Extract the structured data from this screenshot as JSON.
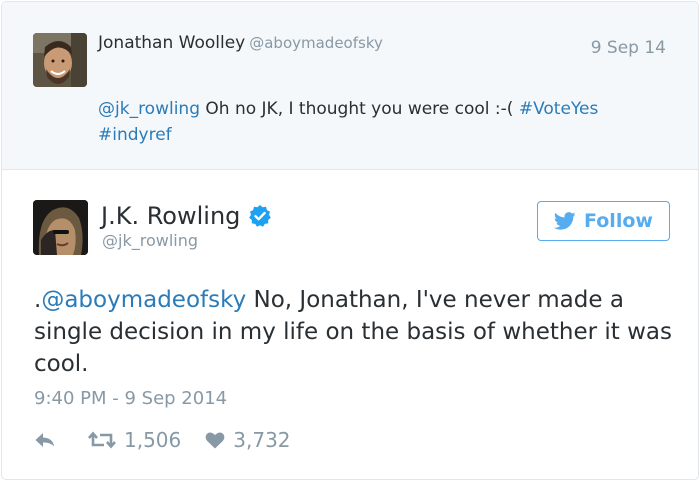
{
  "reply_tweet": {
    "author_name": "Jonathan Woolley",
    "author_handle": "@aboymadeofsky",
    "date": "9 Sep 14",
    "mention": "@jk_rowling",
    "text": " Oh no JK, I thought you were cool :-( ",
    "hashtag_1": "#VoteYes",
    "hashtag_2": "#indyref"
  },
  "main_tweet": {
    "author_name": "J.K. Rowling",
    "author_handle": "@jk_rowling",
    "verified_icon": "verified-badge-icon",
    "follow_label": "Follow",
    "text_prefix": ".",
    "mention": "@aboymadeofsky",
    "text": " No, Jonathan, I've never made a single decision in my life on the basis of whether it was cool.",
    "timestamp": "9:40 PM - 9 Sep 2014",
    "retweet_count": "1,506",
    "like_count": "3,732"
  },
  "colors": {
    "link": "#2b7bb9",
    "accent": "#55acee",
    "muted": "#8899a6",
    "text": "#292f33",
    "reply_background": "#f5f8fa"
  }
}
